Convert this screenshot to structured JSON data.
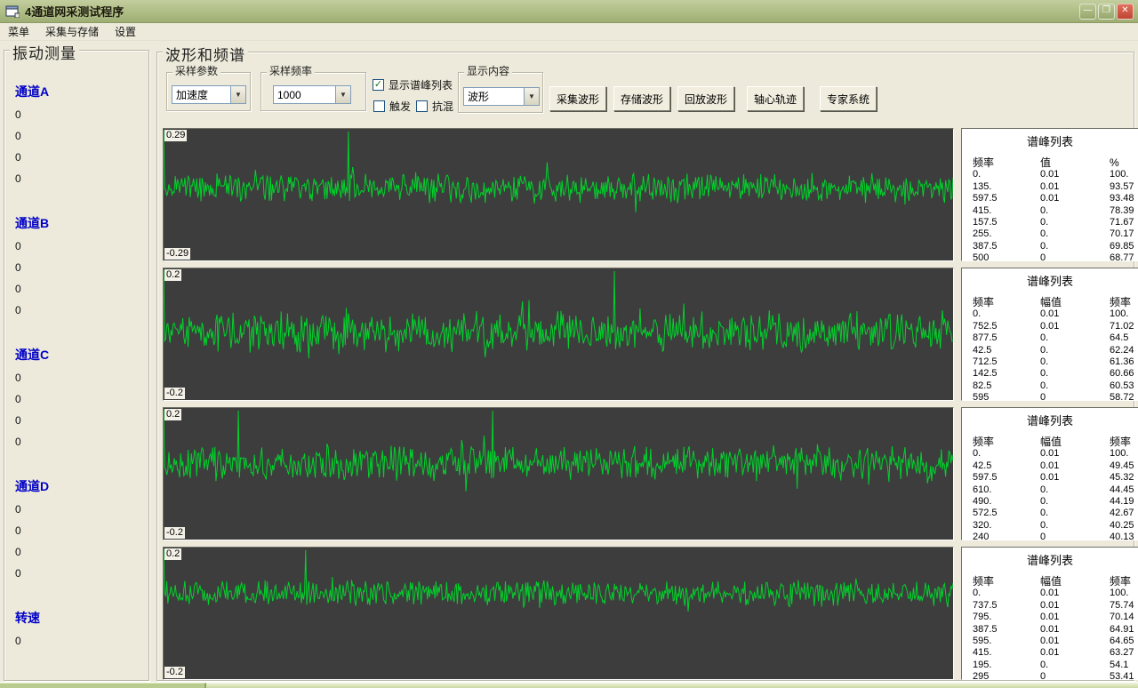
{
  "window": {
    "title": "4通道网采测试程序",
    "controls": {
      "minimize": "—",
      "restore": "❐",
      "close": "✕"
    }
  },
  "menu": {
    "items": [
      "菜单",
      "采集与存储",
      "设置"
    ]
  },
  "sidebar": {
    "title": "振动测量",
    "channels": [
      {
        "label": "通道A",
        "values": [
          "0",
          "0",
          "0",
          "0"
        ]
      },
      {
        "label": "通道B",
        "values": [
          "0",
          "0",
          "0",
          "0"
        ]
      },
      {
        "label": "通道C",
        "values": [
          "0",
          "0",
          "0",
          "0"
        ]
      },
      {
        "label": "通道D",
        "values": [
          "0",
          "0",
          "0",
          "0"
        ]
      },
      {
        "label": "转速",
        "values": [
          "0"
        ]
      }
    ]
  },
  "main": {
    "title": "波形和频谱",
    "toolbar": {
      "sample_param": {
        "label": "采样参数",
        "value": "加速度"
      },
      "sample_rate": {
        "label": "采样频率",
        "value": "1000"
      },
      "show_peaks": {
        "label": "显示谱峰列表",
        "checked": true
      },
      "trigger": {
        "label": "触发",
        "checked": false
      },
      "antialias": {
        "label": "抗混",
        "checked": false
      },
      "display_content": {
        "label": "显示内容",
        "value": "波形"
      },
      "buttons": [
        "采集波形",
        "存储波形",
        "回放波形",
        "轴心轨迹",
        "专家系统"
      ]
    }
  },
  "colors": {
    "wave": "#00D22B",
    "plot_bg": "#3D3D3D",
    "titlebar": "#ADBB83",
    "channel_blue": "#0000C8"
  },
  "chart_data": [
    {
      "type": "line",
      "name": "channel-A-waveform",
      "ymax_label": "0.29",
      "ymin_label": "-0.29",
      "waveform": {
        "seed": 11,
        "baseline": 0.45,
        "noise": 16,
        "spikes": [
          0.234
        ]
      },
      "peak_table": {
        "title": "谱峰列表",
        "headers": [
          "频率",
          "值",
          "%"
        ],
        "rows": [
          [
            "0.",
            "0.01",
            "100."
          ],
          [
            "135.",
            "0.01",
            "93.57"
          ],
          [
            "597.5",
            "0.01",
            "93.48"
          ],
          [
            "415.",
            "0.",
            "78.39"
          ],
          [
            "157.5",
            "0.",
            "71.67"
          ],
          [
            "255.",
            "0.",
            "70.17"
          ],
          [
            "387.5",
            "0.",
            "69.85"
          ],
          [
            "500",
            "0",
            "68.77"
          ]
        ]
      }
    },
    {
      "type": "line",
      "name": "channel-B-waveform",
      "ymax_label": "0.2",
      "ymin_label": "-0.2",
      "waveform": {
        "seed": 22,
        "baseline": 0.48,
        "noise": 22,
        "spikes": [
          0.571
        ]
      },
      "peak_table": {
        "title": "谱峰列表",
        "headers": [
          "频率",
          "幅值",
          "频率"
        ],
        "rows": [
          [
            "0.",
            "0.01",
            "100."
          ],
          [
            "752.5",
            "0.01",
            "71.02"
          ],
          [
            "877.5",
            "0.",
            "64.5"
          ],
          [
            "42.5",
            "0.",
            "62.24"
          ],
          [
            "712.5",
            "0.",
            "61.36"
          ],
          [
            "142.5",
            "0.",
            "60.66"
          ],
          [
            "82.5",
            "0.",
            "60.53"
          ],
          [
            "595",
            "0",
            "58.72"
          ]
        ]
      }
    },
    {
      "type": "line",
      "name": "channel-C-waveform",
      "ymax_label": "0.2",
      "ymin_label": "-0.2",
      "waveform": {
        "seed": 33,
        "baseline": 0.42,
        "noise": 18,
        "spikes": [
          0.095,
          0.417
        ]
      },
      "peak_table": {
        "title": "谱峰列表",
        "headers": [
          "频率",
          "幅值",
          "频率"
        ],
        "rows": [
          [
            "0.",
            "0.01",
            "100."
          ],
          [
            "42.5",
            "0.01",
            "49.45"
          ],
          [
            "597.5",
            "0.01",
            "45.32"
          ],
          [
            "610.",
            "0.",
            "44.45"
          ],
          [
            "490.",
            "0.",
            "44.19"
          ],
          [
            "572.5",
            "0.",
            "42.67"
          ],
          [
            "320.",
            "0.",
            "40.25"
          ],
          [
            "240",
            "0",
            "40.13"
          ]
        ]
      }
    },
    {
      "type": "line",
      "name": "channel-D-waveform",
      "ymax_label": "0.2",
      "ymin_label": "-0.2",
      "waveform": {
        "seed": 44,
        "baseline": 0.35,
        "noise": 14,
        "spikes": [
          0.18
        ]
      },
      "peak_table": {
        "title": "谱峰列表",
        "headers": [
          "频率",
          "幅值",
          "频率"
        ],
        "rows": [
          [
            "0.",
            "0.01",
            "100."
          ],
          [
            "737.5",
            "0.01",
            "75.74"
          ],
          [
            "795.",
            "0.01",
            "70.14"
          ],
          [
            "387.5",
            "0.01",
            "64.91"
          ],
          [
            "595.",
            "0.01",
            "64.65"
          ],
          [
            "415.",
            "0.01",
            "63.27"
          ],
          [
            "195.",
            "0.",
            "54.1"
          ],
          [
            "295",
            "0",
            "53.41"
          ]
        ]
      }
    }
  ]
}
